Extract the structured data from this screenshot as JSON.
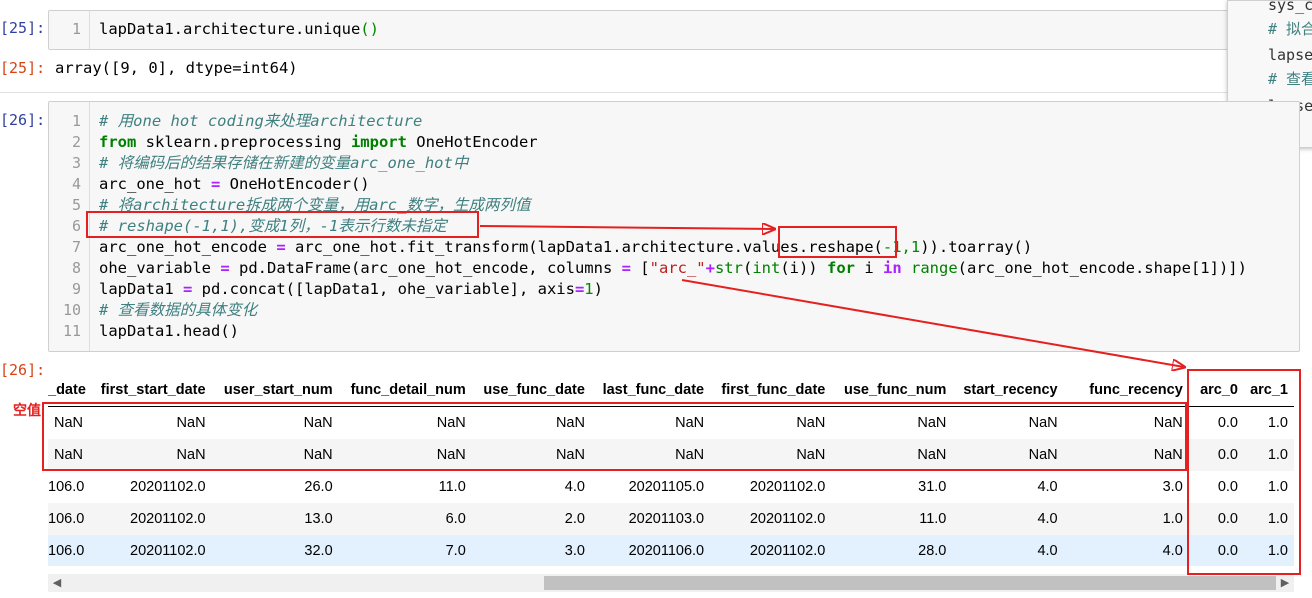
{
  "cell25": {
    "in_prompt": "[25]:",
    "out_prompt": "[25]:",
    "line_numbers": [
      "1"
    ],
    "code": "lapData1.architecture.unique",
    "code_parens": "()",
    "output": "array([9, 0], dtype=int64)"
  },
  "cell26": {
    "in_prompt": "[26]:",
    "out_prompt": "[26]:",
    "line_numbers": [
      "1",
      "2",
      "3",
      "4",
      "5",
      "6",
      "7",
      "8",
      "9",
      "10",
      "11"
    ],
    "lines": {
      "l1": "# 用one hot coding来处理architecture",
      "l2_kw1": "from",
      "l2_mod": " sklearn.preprocessing ",
      "l2_kw2": "import",
      "l2_name": " OneHotEncoder",
      "l3": "# 将编码后的结果存储在新建的变量arc_one_hot中",
      "l4_a": "arc_one_hot ",
      "l4_op": "=",
      "l4_b": " OneHotEncoder()",
      "l5": "# 将architecture拆成两个变量，用arc_数字，生成两列值",
      "l6": "# reshape(-1,1),变成1列，-1表示行数未指定",
      "l7_a": "arc_one_hot_encode ",
      "l7_op": "=",
      "l7_b": " arc_one_hot.fit_transform(lapData1.architecture.values.reshape(",
      "l7_num": "-1,1",
      "l7_c": ")).toarray()",
      "l8_a": "ohe_variable ",
      "l8_op1": "=",
      "l8_b": " pd.DataFrame(arc_one_hot_encode, columns ",
      "l8_op2": "=",
      "l8_c": " [",
      "l8_str": "\"arc_\"",
      "l8_op3": "+",
      "l8_d": "str",
      "l8_e": "(",
      "l8_f": "int",
      "l8_g": "(i)) ",
      "l8_kw1": "for",
      "l8_h": " i ",
      "l8_kw2": "in",
      "l8_i": " ",
      "l8_j": "range",
      "l8_k": "(arc_one_hot_encode.shape[1])])",
      "l9_a": "lapData1 ",
      "l9_op": "=",
      "l9_b": " pd.concat([lapData1, ohe_variable], axis",
      "l9_op2": "=",
      "l9_num": "1",
      "l9_c": ")",
      "l10": "# 查看数据的具体变化",
      "l11": "lapData1.head()"
    }
  },
  "popup": {
    "lines": [
      "sys_c",
      "# 拟合",
      "lapse",
      "# 查看",
      "lapse"
    ]
  },
  "table": {
    "columns": [
      "_date",
      "first_start_date",
      "user_start_num",
      "func_detail_num",
      "use_func_date",
      "last_func_date",
      "first_func_date",
      "use_func_num",
      "start_recency",
      "func_recency",
      "arc_0",
      "arc_1"
    ],
    "rows": [
      [
        "NaN",
        "NaN",
        "NaN",
        "NaN",
        "NaN",
        "NaN",
        "NaN",
        "NaN",
        "NaN",
        "NaN",
        "0.0",
        "1.0"
      ],
      [
        "NaN",
        "NaN",
        "NaN",
        "NaN",
        "NaN",
        "NaN",
        "NaN",
        "NaN",
        "NaN",
        "NaN",
        "0.0",
        "1.0"
      ],
      [
        "106.0",
        "20201102.0",
        "26.0",
        "11.0",
        "4.0",
        "20201105.0",
        "20201102.0",
        "31.0",
        "4.0",
        "3.0",
        "0.0",
        "1.0"
      ],
      [
        "106.0",
        "20201102.0",
        "13.0",
        "6.0",
        "2.0",
        "20201103.0",
        "20201102.0",
        "11.0",
        "4.0",
        "1.0",
        "0.0",
        "1.0"
      ],
      [
        "106.0",
        "20201102.0",
        "32.0",
        "7.0",
        "3.0",
        "20201106.0",
        "20201102.0",
        "28.0",
        "4.0",
        "4.0",
        "0.0",
        "1.0"
      ]
    ]
  },
  "annotation": {
    "null_label": "空值",
    "color": "#e52020"
  },
  "scroll": {
    "left_arrow": "◀",
    "right_arrow": "▶"
  }
}
